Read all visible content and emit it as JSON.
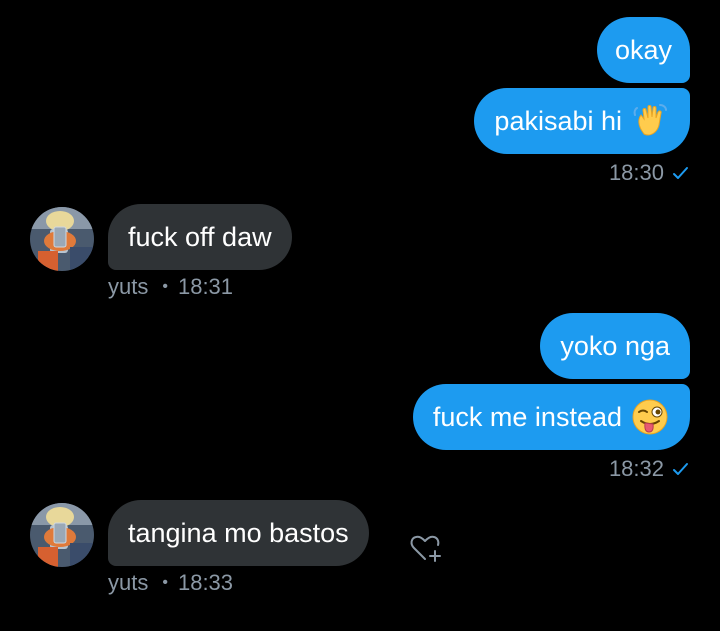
{
  "messages": [
    {
      "id": "m1",
      "text": "okay"
    },
    {
      "id": "m2",
      "text": "pakisabi hi"
    },
    {
      "id": "m3",
      "text": "fuck off daw"
    },
    {
      "id": "m4",
      "text": "yoko nga"
    },
    {
      "id": "m5",
      "text": "fuck me instead"
    },
    {
      "id": "m6",
      "text": "tangina mo bastos"
    }
  ],
  "meta": {
    "out1_time": "18:30",
    "in1_user": "yuts",
    "in1_time": "18:31",
    "out2_time": "18:32",
    "in2_user": "yuts",
    "in2_time": "18:33",
    "separator": "•"
  },
  "icons": {
    "wave": "waving-hand-emoji",
    "wink_tongue": "winking-face-with-tongue-emoji",
    "read_check": "check-icon",
    "react": "add-reaction-heart-icon"
  },
  "colors": {
    "background": "#000000",
    "outgoing_bubble": "#1d9bf0",
    "incoming_bubble": "#2f3336",
    "meta_text": "#8b98a5",
    "check": "#1d9bf0"
  }
}
